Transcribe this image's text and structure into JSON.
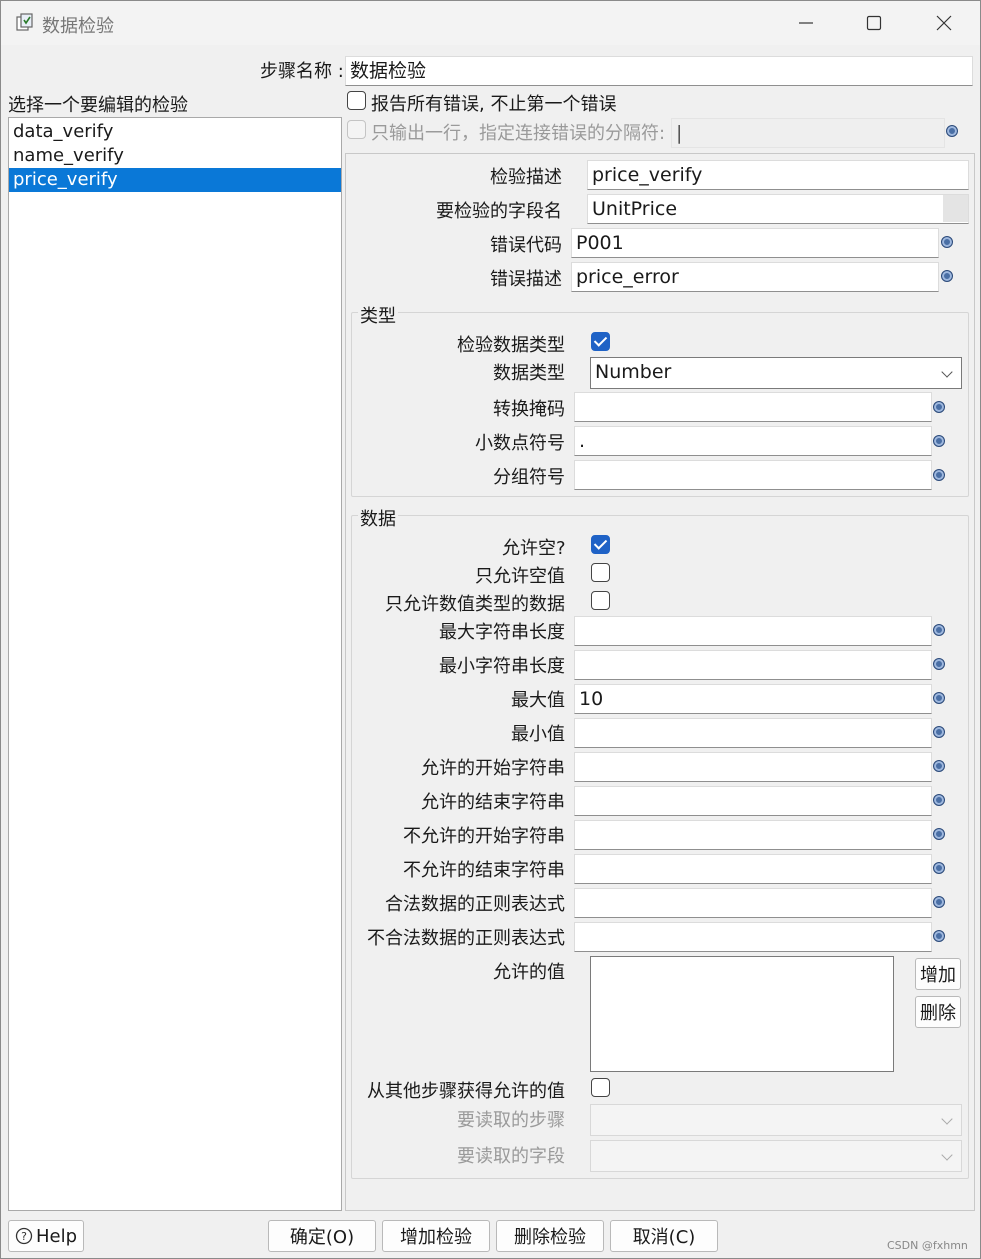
{
  "window": {
    "title": "数据检验",
    "minimize_icon": "minimize-icon",
    "maximize_icon": "maximize-icon",
    "close_icon": "close-icon"
  },
  "step_name": {
    "label": "步骤名称 :",
    "value": "数据检验"
  },
  "left_panel": {
    "header": "选择一个要编辑的检验",
    "items": [
      "data_verify",
      "name_verify",
      "price_verify"
    ],
    "selected_index": 2
  },
  "options": {
    "report_all_errors": {
      "label": "报告所有错误, 不止第一个错误",
      "checked": false
    },
    "single_row": {
      "label": "只输出一行，指定连接错误的分隔符:",
      "checked": false,
      "value": "|"
    }
  },
  "details": {
    "description": {
      "label": "检验描述",
      "value": "price_verify"
    },
    "field_name": {
      "label": "要检验的字段名",
      "value": "UnitPrice"
    },
    "error_code": {
      "label": "错误代码",
      "value": "P001"
    },
    "error_desc": {
      "label": "错误描述",
      "value": "price_error"
    }
  },
  "type_group": {
    "title": "类型",
    "verify_type": {
      "label": "检验数据类型",
      "checked": true
    },
    "data_type": {
      "label": "数据类型",
      "value": "Number"
    },
    "conversion_mask": {
      "label": "转换掩码",
      "value": ""
    },
    "decimal_symbol": {
      "label": "小数点符号",
      "value": "."
    },
    "grouping_symbol": {
      "label": "分组符号",
      "value": ""
    }
  },
  "data_group": {
    "title": "数据",
    "allow_null": {
      "label": "允许空?",
      "checked": true
    },
    "only_null": {
      "label": "只允许空值",
      "checked": false
    },
    "only_numeric": {
      "label": "只允许数值类型的数据",
      "checked": false
    },
    "max_length": {
      "label": "最大字符串长度",
      "value": ""
    },
    "min_length": {
      "label": "最小字符串长度",
      "value": ""
    },
    "max_value": {
      "label": "最大值",
      "value": "10"
    },
    "min_value": {
      "label": "最小值",
      "value": ""
    },
    "allowed_start": {
      "label": "允许的开始字符串",
      "value": ""
    },
    "allowed_end": {
      "label": "允许的结束字符串",
      "value": ""
    },
    "disallowed_start": {
      "label": "不允许的开始字符串",
      "value": ""
    },
    "disallowed_end": {
      "label": "不允许的结束字符串",
      "value": ""
    },
    "valid_regex": {
      "label": "合法数据的正则表达式",
      "value": ""
    },
    "invalid_regex": {
      "label": "不合法数据的正则表达式",
      "value": ""
    },
    "allowed_values": {
      "label": "允许的值",
      "add_label": "增加",
      "delete_label": "删除"
    },
    "from_other_step": {
      "label": "从其他步骤获得允许的值",
      "checked": false
    },
    "read_step": {
      "label": "要读取的步骤",
      "value": ""
    },
    "read_field": {
      "label": "要读取的字段",
      "value": ""
    }
  },
  "footer": {
    "help_label": "Help",
    "ok_label": "确定(O)",
    "add_label": "增加检验",
    "delete_label": "删除检验",
    "cancel_label": "取消(C)",
    "watermark": "CSDN @fxhmn"
  },
  "colors": {
    "selection": "#0a78d7",
    "checkbox_checked": "#1f62c6",
    "window_bg": "#f0f0f0"
  }
}
